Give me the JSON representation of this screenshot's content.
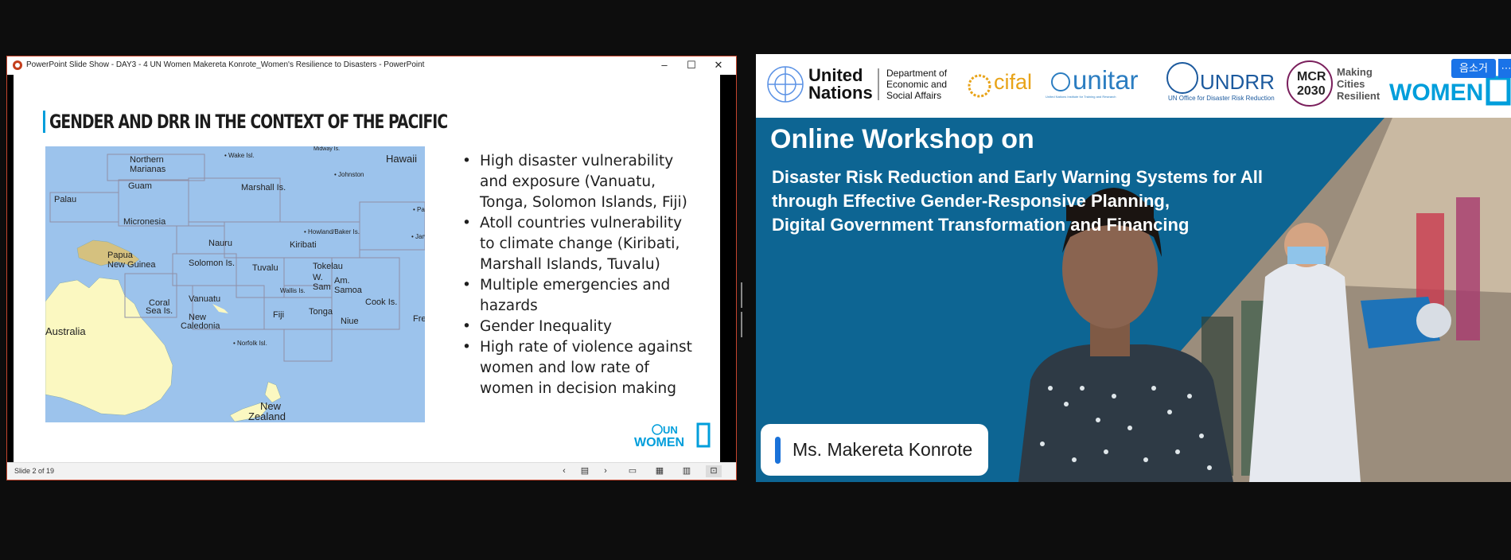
{
  "ppt_window": {
    "title": "PowerPoint Slide Show  -  DAY3 - 4 UN Women Makereta Konrote_Women's Resilience to Disasters - PowerPoint",
    "status": "Slide 2 of 19"
  },
  "slide": {
    "heading": "GENDER AND DRR IN THE CONTEXT OF THE PACIFIC",
    "bullets": [
      "High disaster vulnerability and exposure (Vanuatu, Tonga, Solomon Islands, Fiji)",
      "Atoll countries vulnerability to climate change (Kiribati, Marshall Islands, Tuvalu)",
      "Multiple emergencies and hazards",
      "Gender Inequality",
      "High rate of violence against women and low rate of women in decision making"
    ],
    "map_labels": {
      "hawaii": "Hawaii",
      "northern_marianas": "Northern",
      "northern_marianas2": "Marianas",
      "guam": "Guam",
      "palau": "Palau",
      "micronesia": "Micronesia",
      "marshall": "Marshall Is.",
      "wake": "• Wake Isl.",
      "johnston": "• Johnston",
      "palmyra": "• Palmyra",
      "howland": "• Howland/Baker Is.",
      "jarvis": "• Jarvis",
      "nauru": "Nauru",
      "kiribati": "Kiribati",
      "png1": "Papua",
      "png2": "New Guinea",
      "solomon": "Solomon Is.",
      "tuvalu": "Tuvalu",
      "tokelau": "Tokelau",
      "wallis": "Wallis Is.",
      "w_samoa1": "W.",
      "w_samoa2": "Sam",
      "am_samoa1": "Am.",
      "am_samoa2": "Samoa",
      "vanuatu": "Vanuatu",
      "coral1": "Coral",
      "coral2": "Sea Is.",
      "fiji": "Fiji",
      "tonga": "Tonga",
      "niue": "Niue",
      "cook": "Cook Is.",
      "fre": "Fre",
      "new_caledonia1": "New",
      "new_caledonia2": "Caledonia",
      "australia": "Australia",
      "norfolk": "• Norfolk Isl.",
      "nz1": "New",
      "nz2": "Zealand",
      "midway": "Midway Is."
    },
    "logo": {
      "top": "UN",
      "bottom": "WOMEN"
    }
  },
  "video": {
    "banner": {
      "un1": "United",
      "un2": "Nations",
      "desa1": "Department of",
      "desa2": "Economic and",
      "desa3": "Social Affairs",
      "cifal": "cifal",
      "unitar": "unitar",
      "unitar_sub": "United Nations Institute for Training and Research",
      "undrr": "UNDRR",
      "undrr_sub": "UN Office for Disaster Risk Reduction",
      "mcr1": "MCR",
      "mcr2": "2030",
      "mcr_t1": "Making",
      "mcr_t2": "Cities",
      "mcr_t3": "Resilient",
      "women": "WOMEN"
    },
    "workshop_title": "Online Workshop on",
    "workshop_lines": [
      "Disaster Risk Reduction and Early Warning Systems for All",
      "through Effective Gender-Responsive Planning,",
      "Digital Government Transformation and Financing"
    ],
    "speaker": "Ms. Makereta Konrote",
    "tag": "음소거",
    "tag_more": "⋯"
  },
  "colors": {
    "ppt_accent": "#c43e1c",
    "un_blue": "#009edb",
    "video_blue": "#0d6593",
    "name_accent": "#1a72d9"
  }
}
